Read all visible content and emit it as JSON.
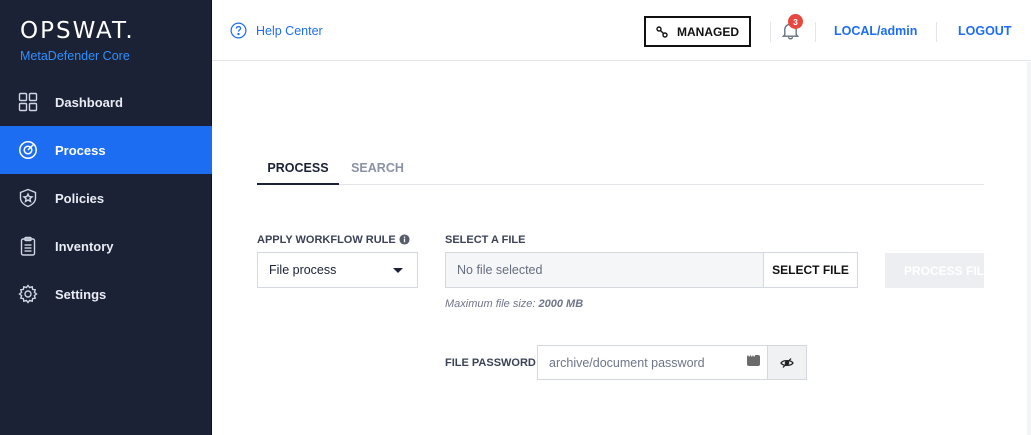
{
  "brand": {
    "logo": "OPSWAT.",
    "product": "MetaDefender Core"
  },
  "nav": {
    "items": [
      {
        "label": "Dashboard",
        "icon": "dashboard-icon"
      },
      {
        "label": "Process",
        "icon": "process-icon",
        "active": true
      },
      {
        "label": "Policies",
        "icon": "policies-icon"
      },
      {
        "label": "Inventory",
        "icon": "inventory-icon"
      },
      {
        "label": "Settings",
        "icon": "settings-icon"
      }
    ]
  },
  "header": {
    "help_label": "Help Center",
    "managed_label": "MANAGED",
    "notification_count": "3",
    "user_label": "LOCAL/admin",
    "logout_label": "LOGOUT"
  },
  "tabs": [
    {
      "label": "PROCESS",
      "active": true
    },
    {
      "label": "SEARCH",
      "active": false
    }
  ],
  "form": {
    "workflow_label": "APPLY WORKFLOW RULE",
    "workflow_value": "File process",
    "file_label": "SELECT A FILE",
    "file_value": "No file selected",
    "select_file_label": "SELECT FILE",
    "process_file_label": "PROCESS FILE",
    "hint_prefix": "Maximum file size: ",
    "hint_value": "2000 MB",
    "password_label": "FILE PASSWORD",
    "password_placeholder": "archive/document password"
  },
  "colors": {
    "sidebar_bg": "#1b2236",
    "accent": "#1d6df3",
    "badge": "#e8473f"
  }
}
